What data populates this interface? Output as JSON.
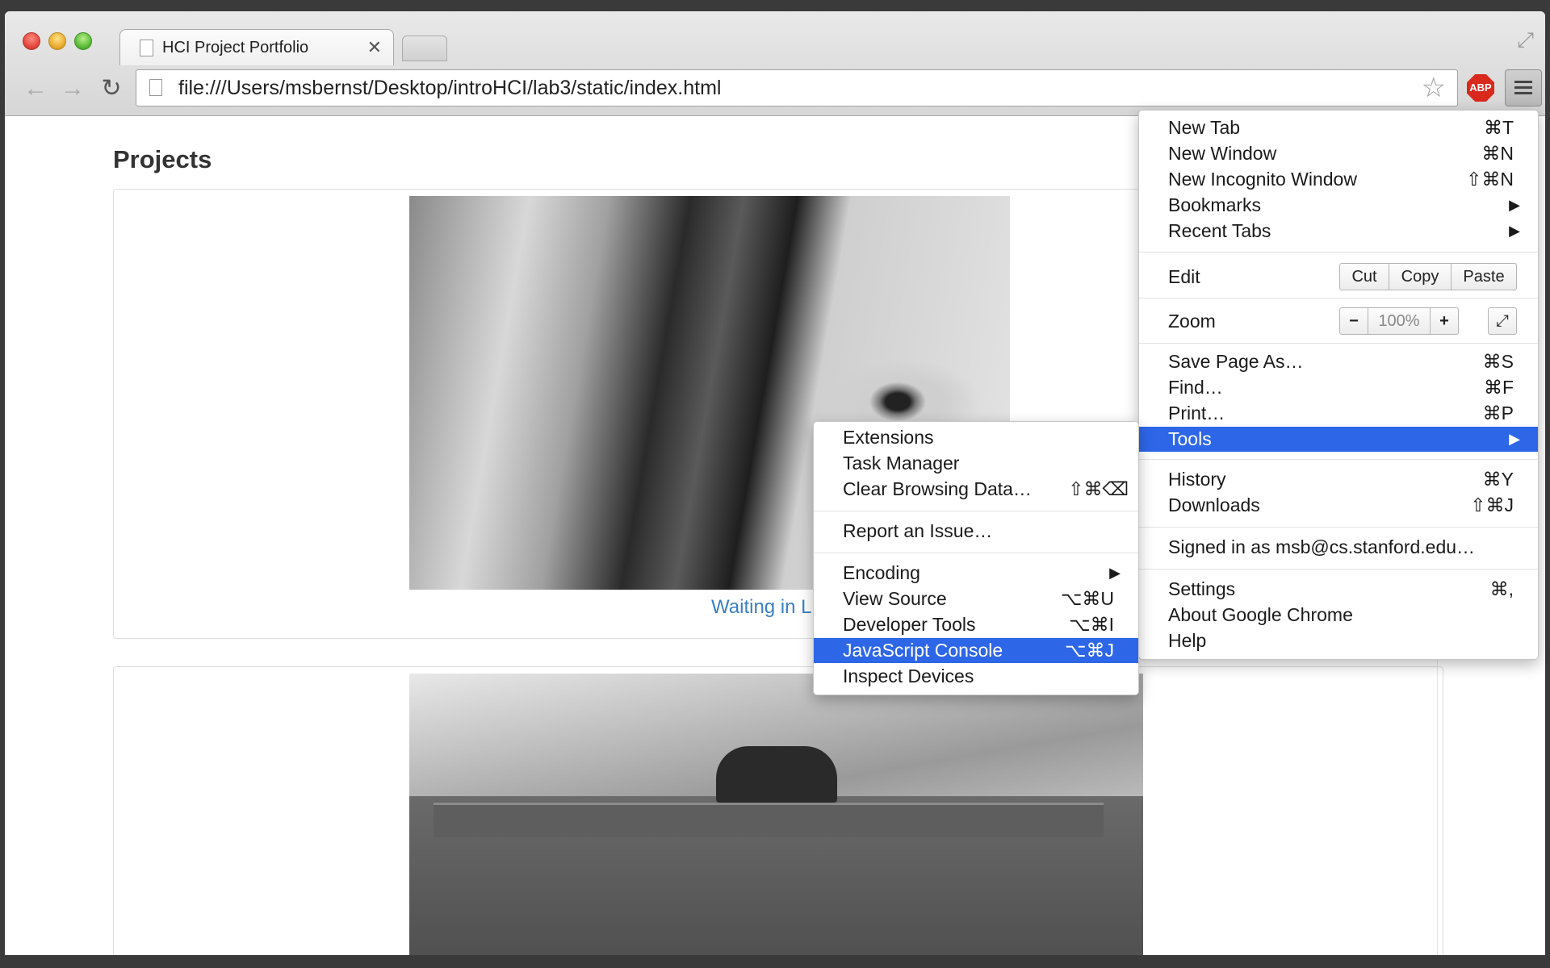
{
  "browser": {
    "tab_title": "HCI Project Portfolio",
    "url": "file:///Users/msbernst/Desktop/introHCI/lab3/static/index.html",
    "extension_label": "ABP"
  },
  "page": {
    "heading": "Projects",
    "caption1": "Waiting in L"
  },
  "main_menu": {
    "new_tab": {
      "label": "New Tab",
      "shortcut": "⌘T"
    },
    "new_window": {
      "label": "New Window",
      "shortcut": "⌘N"
    },
    "new_incognito": {
      "label": "New Incognito Window",
      "shortcut": "⇧⌘N"
    },
    "bookmarks": {
      "label": "Bookmarks"
    },
    "recent_tabs": {
      "label": "Recent Tabs"
    },
    "edit": {
      "label": "Edit",
      "cut": "Cut",
      "copy": "Copy",
      "paste": "Paste"
    },
    "zoom": {
      "label": "Zoom",
      "minus": "−",
      "value": "100%",
      "plus": "+"
    },
    "save_page": {
      "label": "Save Page As…",
      "shortcut": "⌘S"
    },
    "find": {
      "label": "Find…",
      "shortcut": "⌘F"
    },
    "print": {
      "label": "Print…",
      "shortcut": "⌘P"
    },
    "tools": {
      "label": "Tools"
    },
    "history": {
      "label": "History",
      "shortcut": "⌘Y"
    },
    "downloads": {
      "label": "Downloads",
      "shortcut": "⇧⌘J"
    },
    "signed_in": {
      "label": "Signed in as msb@cs.stanford.edu…"
    },
    "settings": {
      "label": "Settings",
      "shortcut": "⌘,"
    },
    "about": {
      "label": "About Google Chrome"
    },
    "help": {
      "label": "Help"
    }
  },
  "tools_menu": {
    "extensions": {
      "label": "Extensions"
    },
    "task_manager": {
      "label": "Task Manager"
    },
    "clear_data": {
      "label": "Clear Browsing Data…",
      "shortcut": "⇧⌘⌫"
    },
    "report_issue": {
      "label": "Report an Issue…"
    },
    "encoding": {
      "label": "Encoding"
    },
    "view_source": {
      "label": "View Source",
      "shortcut": "⌥⌘U"
    },
    "dev_tools": {
      "label": "Developer Tools",
      "shortcut": "⌥⌘I"
    },
    "js_console": {
      "label": "JavaScript Console",
      "shortcut": "⌥⌘J"
    },
    "inspect_devices": {
      "label": "Inspect Devices"
    }
  },
  "icons": {
    "submenu_arrow": "▶",
    "back": "back-arrow-icon",
    "forward": "forward-arrow-icon",
    "reload": "reload-icon",
    "bookmark_star": "star-icon"
  },
  "colors": {
    "highlight": "#2e66e8",
    "link": "#3a7fc1",
    "abp": "#d9291c"
  }
}
